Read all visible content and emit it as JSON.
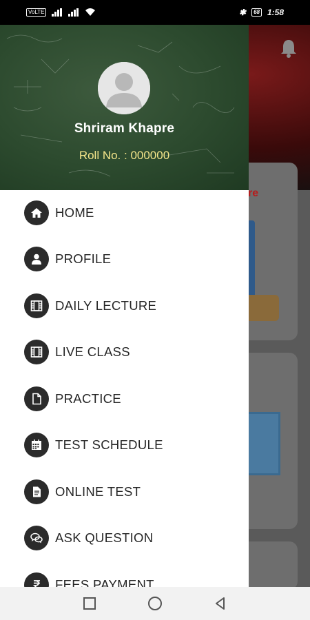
{
  "status_bar": {
    "network_chip_left": "VoLTE",
    "battery": "68",
    "time": "1:58"
  },
  "background_app": {
    "card_text": "re"
  },
  "drawer": {
    "user_name": "Shriram Khapre",
    "roll_number": "Roll No. : 000000",
    "menu": [
      {
        "label": "HOME",
        "icon": "home-icon"
      },
      {
        "label": "PROFILE",
        "icon": "person-icon"
      },
      {
        "label": "DAILY LECTURE",
        "icon": "film-icon"
      },
      {
        "label": "LIVE CLASS",
        "icon": "film-icon"
      },
      {
        "label": "PRACTICE",
        "icon": "document-icon"
      },
      {
        "label": "TEST SCHEDULE",
        "icon": "calendar-icon"
      },
      {
        "label": "ONLINE TEST",
        "icon": "test-document-icon"
      },
      {
        "label": "ASK QUESTION",
        "icon": "chat-icon"
      },
      {
        "label": "FEES PAYMENT",
        "icon": "rupee-icon"
      }
    ]
  },
  "colors": {
    "drawer_header": "#2c4a2e",
    "roll_text": "#f4e58a",
    "icon_circle": "#2b2b2b"
  }
}
